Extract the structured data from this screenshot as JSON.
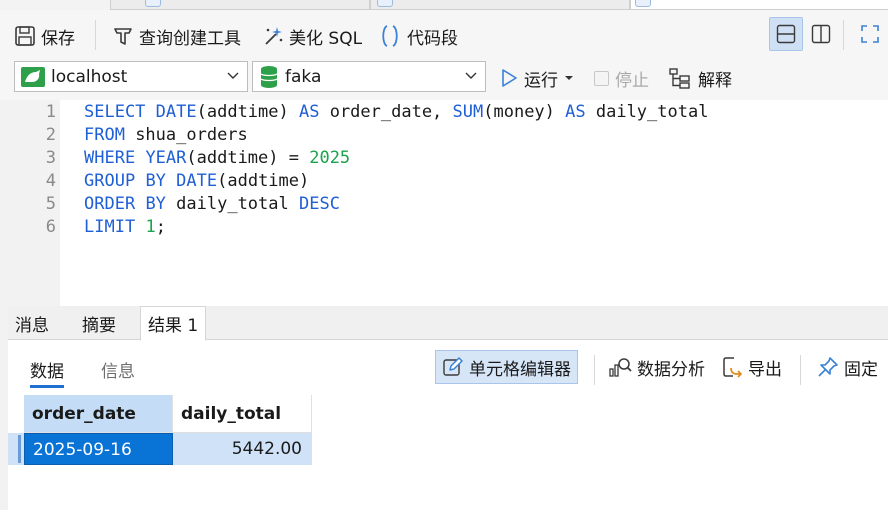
{
  "toolbar": {
    "save": "保存",
    "query_builder": "查询创建工具",
    "beautify": "美化 SQL",
    "snippet": "代码段"
  },
  "connection": {
    "server": "localhost",
    "database": "faka",
    "run": "运行",
    "stop": "停止",
    "explain": "解释"
  },
  "editor": {
    "line_numbers": [
      "1",
      "2",
      "3",
      "4",
      "5",
      "6"
    ],
    "lines": [
      [
        [
          "kw",
          "SELECT"
        ],
        [
          "t",
          " "
        ],
        [
          "kw",
          "DATE"
        ],
        [
          "t",
          "(addtime) "
        ],
        [
          "kw",
          "AS"
        ],
        [
          "t",
          " order_date, "
        ],
        [
          "kw",
          "SUM"
        ],
        [
          "t",
          "(money) "
        ],
        [
          "kw",
          "AS"
        ],
        [
          "t",
          " daily_total"
        ]
      ],
      [
        [
          "kw",
          "FROM"
        ],
        [
          "t",
          " shua_orders"
        ]
      ],
      [
        [
          "kw",
          "WHERE"
        ],
        [
          "t",
          " "
        ],
        [
          "kw",
          "YEAR"
        ],
        [
          "t",
          "(addtime) = "
        ],
        [
          "num",
          "2025"
        ]
      ],
      [
        [
          "kw",
          "GROUP"
        ],
        [
          "t",
          " "
        ],
        [
          "kw",
          "BY"
        ],
        [
          "t",
          " "
        ],
        [
          "kw",
          "DATE"
        ],
        [
          "t",
          "(addtime)"
        ]
      ],
      [
        [
          "kw",
          "ORDER"
        ],
        [
          "t",
          " "
        ],
        [
          "kw",
          "BY"
        ],
        [
          "t",
          " daily_total "
        ],
        [
          "kw",
          "DESC"
        ]
      ],
      [
        [
          "kw",
          "LIMIT"
        ],
        [
          "t",
          " "
        ],
        [
          "num",
          "1"
        ],
        [
          "t",
          ";"
        ]
      ]
    ]
  },
  "result_tabs": {
    "messages": "消息",
    "summary": "摘要",
    "result1": "结果 1"
  },
  "result_toolbar": {
    "data_tab": "数据",
    "info_tab": "信息",
    "cell_editor": "单元格编辑器",
    "data_analysis": "数据分析",
    "export": "导出",
    "pin": "固定"
  },
  "grid": {
    "columns": [
      "order_date",
      "daily_total"
    ],
    "rows": [
      [
        "2025-09-16",
        "5442.00"
      ]
    ]
  },
  "colors": {
    "keyword": "#1f5fd6",
    "number": "#1aa34a",
    "selection": "#0a74d6"
  }
}
